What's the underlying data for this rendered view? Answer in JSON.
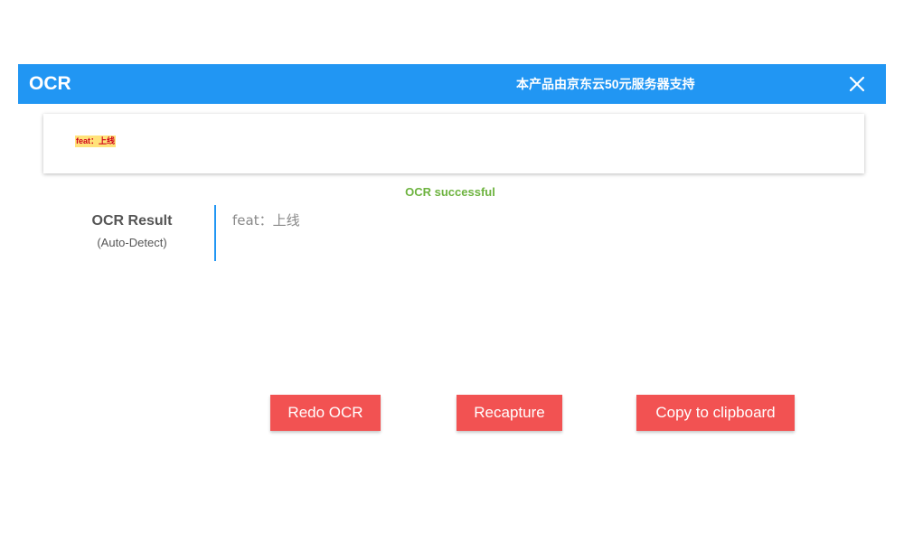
{
  "header": {
    "title": "OCR",
    "sponsor_text": "本产品由京东云50元服务器支持",
    "close_icon": "close-icon"
  },
  "capture": {
    "preview_text": "feat：上线"
  },
  "status": {
    "message": "OCR successful",
    "color": "#6db33f"
  },
  "result": {
    "label": "OCR Result",
    "sublabel": "(Auto-Detect)",
    "text": "feat：上线"
  },
  "actions": {
    "redo_label": "Redo OCR",
    "recapture_label": "Recapture",
    "copy_label": "Copy to clipboard"
  },
  "colors": {
    "accent": "#2196f3",
    "button": "#f25252",
    "success": "#6db33f"
  }
}
